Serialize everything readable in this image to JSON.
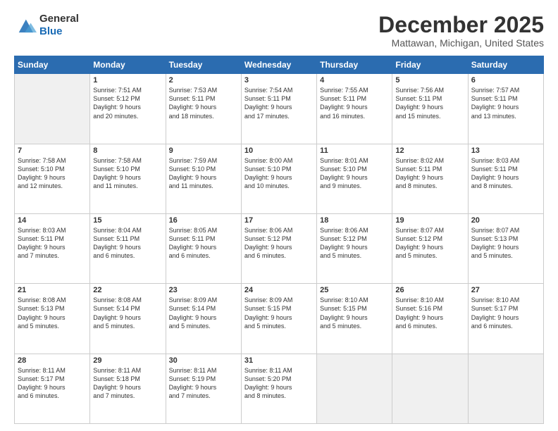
{
  "logo": {
    "line1": "General",
    "line2": "Blue"
  },
  "header": {
    "title": "December 2025",
    "location": "Mattawan, Michigan, United States"
  },
  "weekdays": [
    "Sunday",
    "Monday",
    "Tuesday",
    "Wednesday",
    "Thursday",
    "Friday",
    "Saturday"
  ],
  "weeks": [
    [
      {
        "day": "",
        "content": ""
      },
      {
        "day": "1",
        "content": "Sunrise: 7:51 AM\nSunset: 5:12 PM\nDaylight: 9 hours\nand 20 minutes."
      },
      {
        "day": "2",
        "content": "Sunrise: 7:53 AM\nSunset: 5:11 PM\nDaylight: 9 hours\nand 18 minutes."
      },
      {
        "day": "3",
        "content": "Sunrise: 7:54 AM\nSunset: 5:11 PM\nDaylight: 9 hours\nand 17 minutes."
      },
      {
        "day": "4",
        "content": "Sunrise: 7:55 AM\nSunset: 5:11 PM\nDaylight: 9 hours\nand 16 minutes."
      },
      {
        "day": "5",
        "content": "Sunrise: 7:56 AM\nSunset: 5:11 PM\nDaylight: 9 hours\nand 15 minutes."
      },
      {
        "day": "6",
        "content": "Sunrise: 7:57 AM\nSunset: 5:11 PM\nDaylight: 9 hours\nand 13 minutes."
      }
    ],
    [
      {
        "day": "7",
        "content": "Sunrise: 7:58 AM\nSunset: 5:10 PM\nDaylight: 9 hours\nand 12 minutes."
      },
      {
        "day": "8",
        "content": "Sunrise: 7:58 AM\nSunset: 5:10 PM\nDaylight: 9 hours\nand 11 minutes."
      },
      {
        "day": "9",
        "content": "Sunrise: 7:59 AM\nSunset: 5:10 PM\nDaylight: 9 hours\nand 11 minutes."
      },
      {
        "day": "10",
        "content": "Sunrise: 8:00 AM\nSunset: 5:10 PM\nDaylight: 9 hours\nand 10 minutes."
      },
      {
        "day": "11",
        "content": "Sunrise: 8:01 AM\nSunset: 5:10 PM\nDaylight: 9 hours\nand 9 minutes."
      },
      {
        "day": "12",
        "content": "Sunrise: 8:02 AM\nSunset: 5:11 PM\nDaylight: 9 hours\nand 8 minutes."
      },
      {
        "day": "13",
        "content": "Sunrise: 8:03 AM\nSunset: 5:11 PM\nDaylight: 9 hours\nand 8 minutes."
      }
    ],
    [
      {
        "day": "14",
        "content": "Sunrise: 8:03 AM\nSunset: 5:11 PM\nDaylight: 9 hours\nand 7 minutes."
      },
      {
        "day": "15",
        "content": "Sunrise: 8:04 AM\nSunset: 5:11 PM\nDaylight: 9 hours\nand 6 minutes."
      },
      {
        "day": "16",
        "content": "Sunrise: 8:05 AM\nSunset: 5:11 PM\nDaylight: 9 hours\nand 6 minutes."
      },
      {
        "day": "17",
        "content": "Sunrise: 8:06 AM\nSunset: 5:12 PM\nDaylight: 9 hours\nand 6 minutes."
      },
      {
        "day": "18",
        "content": "Sunrise: 8:06 AM\nSunset: 5:12 PM\nDaylight: 9 hours\nand 5 minutes."
      },
      {
        "day": "19",
        "content": "Sunrise: 8:07 AM\nSunset: 5:12 PM\nDaylight: 9 hours\nand 5 minutes."
      },
      {
        "day": "20",
        "content": "Sunrise: 8:07 AM\nSunset: 5:13 PM\nDaylight: 9 hours\nand 5 minutes."
      }
    ],
    [
      {
        "day": "21",
        "content": "Sunrise: 8:08 AM\nSunset: 5:13 PM\nDaylight: 9 hours\nand 5 minutes."
      },
      {
        "day": "22",
        "content": "Sunrise: 8:08 AM\nSunset: 5:14 PM\nDaylight: 9 hours\nand 5 minutes."
      },
      {
        "day": "23",
        "content": "Sunrise: 8:09 AM\nSunset: 5:14 PM\nDaylight: 9 hours\nand 5 minutes."
      },
      {
        "day": "24",
        "content": "Sunrise: 8:09 AM\nSunset: 5:15 PM\nDaylight: 9 hours\nand 5 minutes."
      },
      {
        "day": "25",
        "content": "Sunrise: 8:10 AM\nSunset: 5:15 PM\nDaylight: 9 hours\nand 5 minutes."
      },
      {
        "day": "26",
        "content": "Sunrise: 8:10 AM\nSunset: 5:16 PM\nDaylight: 9 hours\nand 6 minutes."
      },
      {
        "day": "27",
        "content": "Sunrise: 8:10 AM\nSunset: 5:17 PM\nDaylight: 9 hours\nand 6 minutes."
      }
    ],
    [
      {
        "day": "28",
        "content": "Sunrise: 8:11 AM\nSunset: 5:17 PM\nDaylight: 9 hours\nand 6 minutes."
      },
      {
        "day": "29",
        "content": "Sunrise: 8:11 AM\nSunset: 5:18 PM\nDaylight: 9 hours\nand 7 minutes."
      },
      {
        "day": "30",
        "content": "Sunrise: 8:11 AM\nSunset: 5:19 PM\nDaylight: 9 hours\nand 7 minutes."
      },
      {
        "day": "31",
        "content": "Sunrise: 8:11 AM\nSunset: 5:20 PM\nDaylight: 9 hours\nand 8 minutes."
      },
      {
        "day": "",
        "content": ""
      },
      {
        "day": "",
        "content": ""
      },
      {
        "day": "",
        "content": ""
      }
    ]
  ]
}
